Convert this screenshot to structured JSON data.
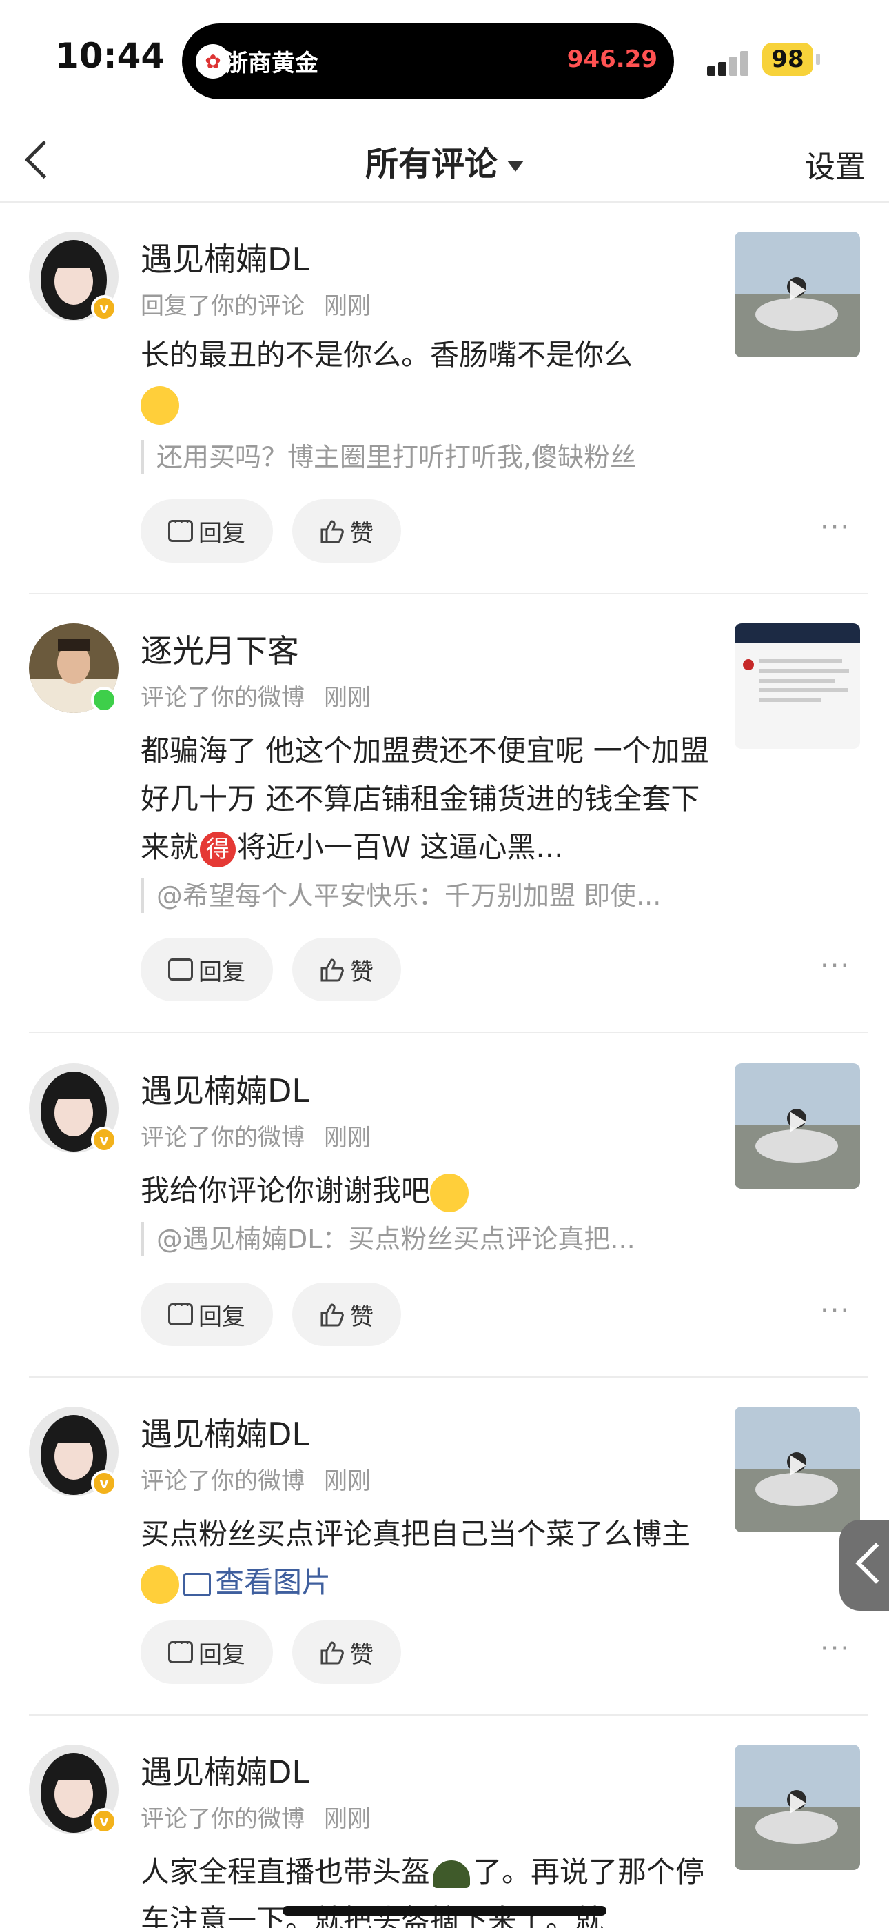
{
  "status": {
    "time": "10:44",
    "island_title": "浙商黄金",
    "island_price": "946.29",
    "battery": "98"
  },
  "nav": {
    "title": "所有评论",
    "settings": "设置"
  },
  "buttons": {
    "reply": "回复",
    "like": "赞"
  },
  "comments": [
    {
      "name": "遇见楠婻DL",
      "action": "回复了你的评论",
      "time": "刚刚",
      "text": "长的最丑的不是你么。香肠嘴不是你么",
      "quote": "还用买吗？博主圈里打听打听我,傻缺粉丝",
      "avatar": "female-avatar",
      "badge": "v"
    },
    {
      "name": "逐光月下客",
      "action": "评论了你的微博",
      "time": "刚刚",
      "text": "都骗海了 他这个加盟费还不便宜呢 一个加盟好几十万 还不算店铺租金铺货进的钱全套下来就",
      "text_mark": "得",
      "text_tail": "将近小一百Ｗ  这逼心黑...",
      "quote": "@希望每个人平安快乐：千万别加盟 即使...",
      "avatar": "male-avatar",
      "badge": "online"
    },
    {
      "name": "遇见楠婻DL",
      "action": "评论了你的微博",
      "time": "刚刚",
      "text": "我给你评论你谢谢我吧",
      "quote": "@遇见楠婻DL：买点粉丝买点评论真把...",
      "avatar": "female-avatar",
      "badge": "v"
    },
    {
      "name": "遇见楠婻DL",
      "action": "评论了你的微博",
      "time": "刚刚",
      "text": "买点粉丝买点评论真把自己当个菜了么博主",
      "link": "查看图片",
      "avatar": "female-avatar",
      "badge": "v"
    },
    {
      "name": "遇见楠婻DL",
      "action": "评论了你的微博",
      "time": "刚刚",
      "text": "人家全程直播也带头盔",
      "text_tail": "了。再说了那个停车注意一下。就把头盔摘下来了。就",
      "avatar": "female-avatar",
      "badge": "v"
    }
  ]
}
